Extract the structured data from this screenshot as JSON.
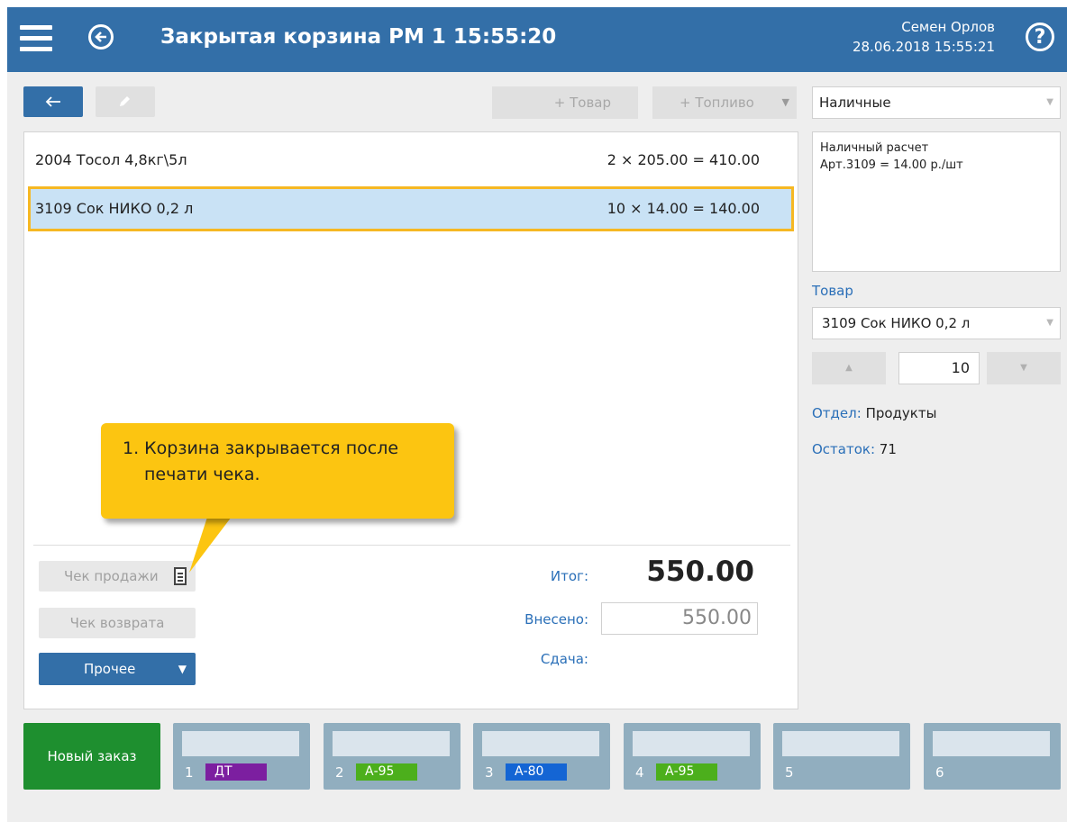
{
  "header": {
    "title": "Закрытая корзина  РМ 1  15:55:20",
    "user_name": "Семен Орлов",
    "datetime": "28.06.2018 15:55:21",
    "help_label": "?"
  },
  "toolbar": {
    "add_product_label": "+ Товар",
    "add_fuel_label": "+ Топливо"
  },
  "cart": {
    "items": [
      {
        "name": "2004  Тосол 4,8кг\\5л",
        "calc": "2 × 205.00 = 410.00",
        "selected": false
      },
      {
        "name": "3109  Сок НИКО 0,2 л",
        "calc": "10 × 14.00 = 140.00",
        "selected": true
      }
    ]
  },
  "tooltip": {
    "line1": "1. Корзина закрывается после",
    "line2": "печати чека."
  },
  "actions": {
    "sale_receipt_label": "Чек продажи",
    "return_receipt_label": "Чек возврата",
    "other_label": "Прочее"
  },
  "totals": {
    "total_label": "Итог:",
    "total_value": "550.00",
    "paid_label": "Внесено:",
    "paid_value": "550.00",
    "change_label": "Сдача:"
  },
  "payment": {
    "method": "Наличные",
    "info_line1": "Наличный расчет",
    "info_line2": "Арт.3109 = 14.00 р./шт"
  },
  "product": {
    "section_label": "Товар",
    "selected": "3109  Сок НИКО 0,2 л",
    "quantity": "10",
    "dept_label": "Отдел:",
    "dept_value": "Продукты",
    "stock_label": "Остаток:",
    "stock_value": "71"
  },
  "orders": {
    "new_order_label": "Новый заказ",
    "tiles": [
      {
        "num": "1",
        "fuel": "ДТ",
        "color": "#7c1fa0"
      },
      {
        "num": "2",
        "fuel": "А-95",
        "color": "#4caf1c"
      },
      {
        "num": "3",
        "fuel": "А-80",
        "color": "#1465d4"
      },
      {
        "num": "4",
        "fuel": "А-95",
        "color": "#4caf1c"
      },
      {
        "num": "5",
        "fuel": "",
        "color": ""
      },
      {
        "num": "6",
        "fuel": "",
        "color": ""
      }
    ]
  },
  "colors": {
    "header": "#336fa8",
    "accent_blue": "#2a6fb8",
    "selection_bg": "#c9e2f5",
    "selection_border": "#f6b823",
    "tooltip": "#fcc511",
    "new_order": "#1e8f2f",
    "tile": "#91aebf"
  },
  "icons": [
    "menu-icon",
    "back-circle-icon",
    "help-icon",
    "arrow-left-icon",
    "pencil-icon",
    "receipt-icon",
    "chevron-down-icon",
    "triangle-up-icon",
    "triangle-down-icon"
  ]
}
